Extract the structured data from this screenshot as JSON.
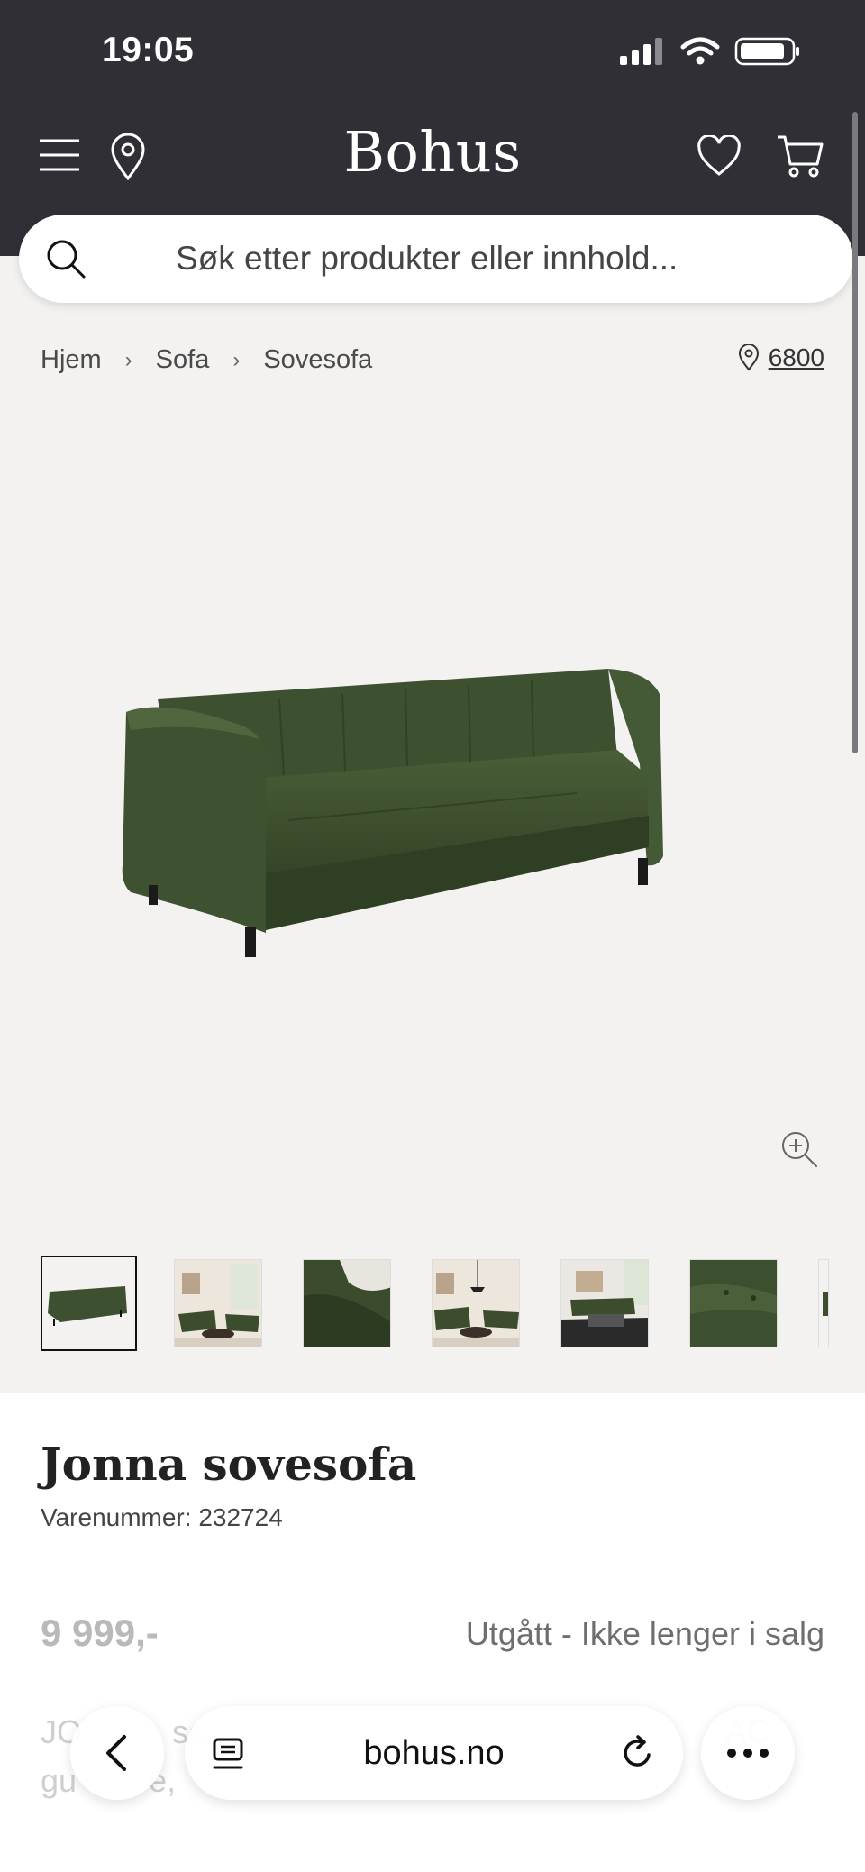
{
  "status_bar": {
    "time": "19:05",
    "icons": [
      "signal-icon",
      "wifi-icon",
      "battery-icon"
    ]
  },
  "header": {
    "logo": "Bohus",
    "icons": [
      "menu-icon",
      "location-pin-icon",
      "heart-icon",
      "cart-icon"
    ]
  },
  "search": {
    "placeholder": "Søk etter produkter eller innhold...",
    "icon": "search-icon"
  },
  "breadcrumb": {
    "items": [
      "Hjem",
      "Sofa",
      "Sovesofa"
    ]
  },
  "store": {
    "icon": "location-pin-icon",
    "code": "6800"
  },
  "gallery": {
    "main_image": "green velvet sofa",
    "zoom_icon": "zoom-in-icon",
    "thumbnails": [
      "sofa-front",
      "living-room-1",
      "detail-armrest",
      "living-room-2",
      "living-room-3",
      "detail-cushion",
      "partial"
    ]
  },
  "product": {
    "title": "Jonna sovesofa",
    "sku": "Varenummer: 232724",
    "price": "9 999,-",
    "availability": "Utgått - Ikke lenger i salg",
    "description_visible": "JO          sc                                                          AC",
    "description_line2": "gu        e,"
  },
  "browser": {
    "url": "bohus.no",
    "icons": [
      "back-icon",
      "tabs-icon",
      "reload-icon",
      "more-icon"
    ]
  },
  "colors": {
    "header_bg": "#302f35",
    "page_bg": "#f4f2f0",
    "sofa": "#3a4d2a"
  }
}
